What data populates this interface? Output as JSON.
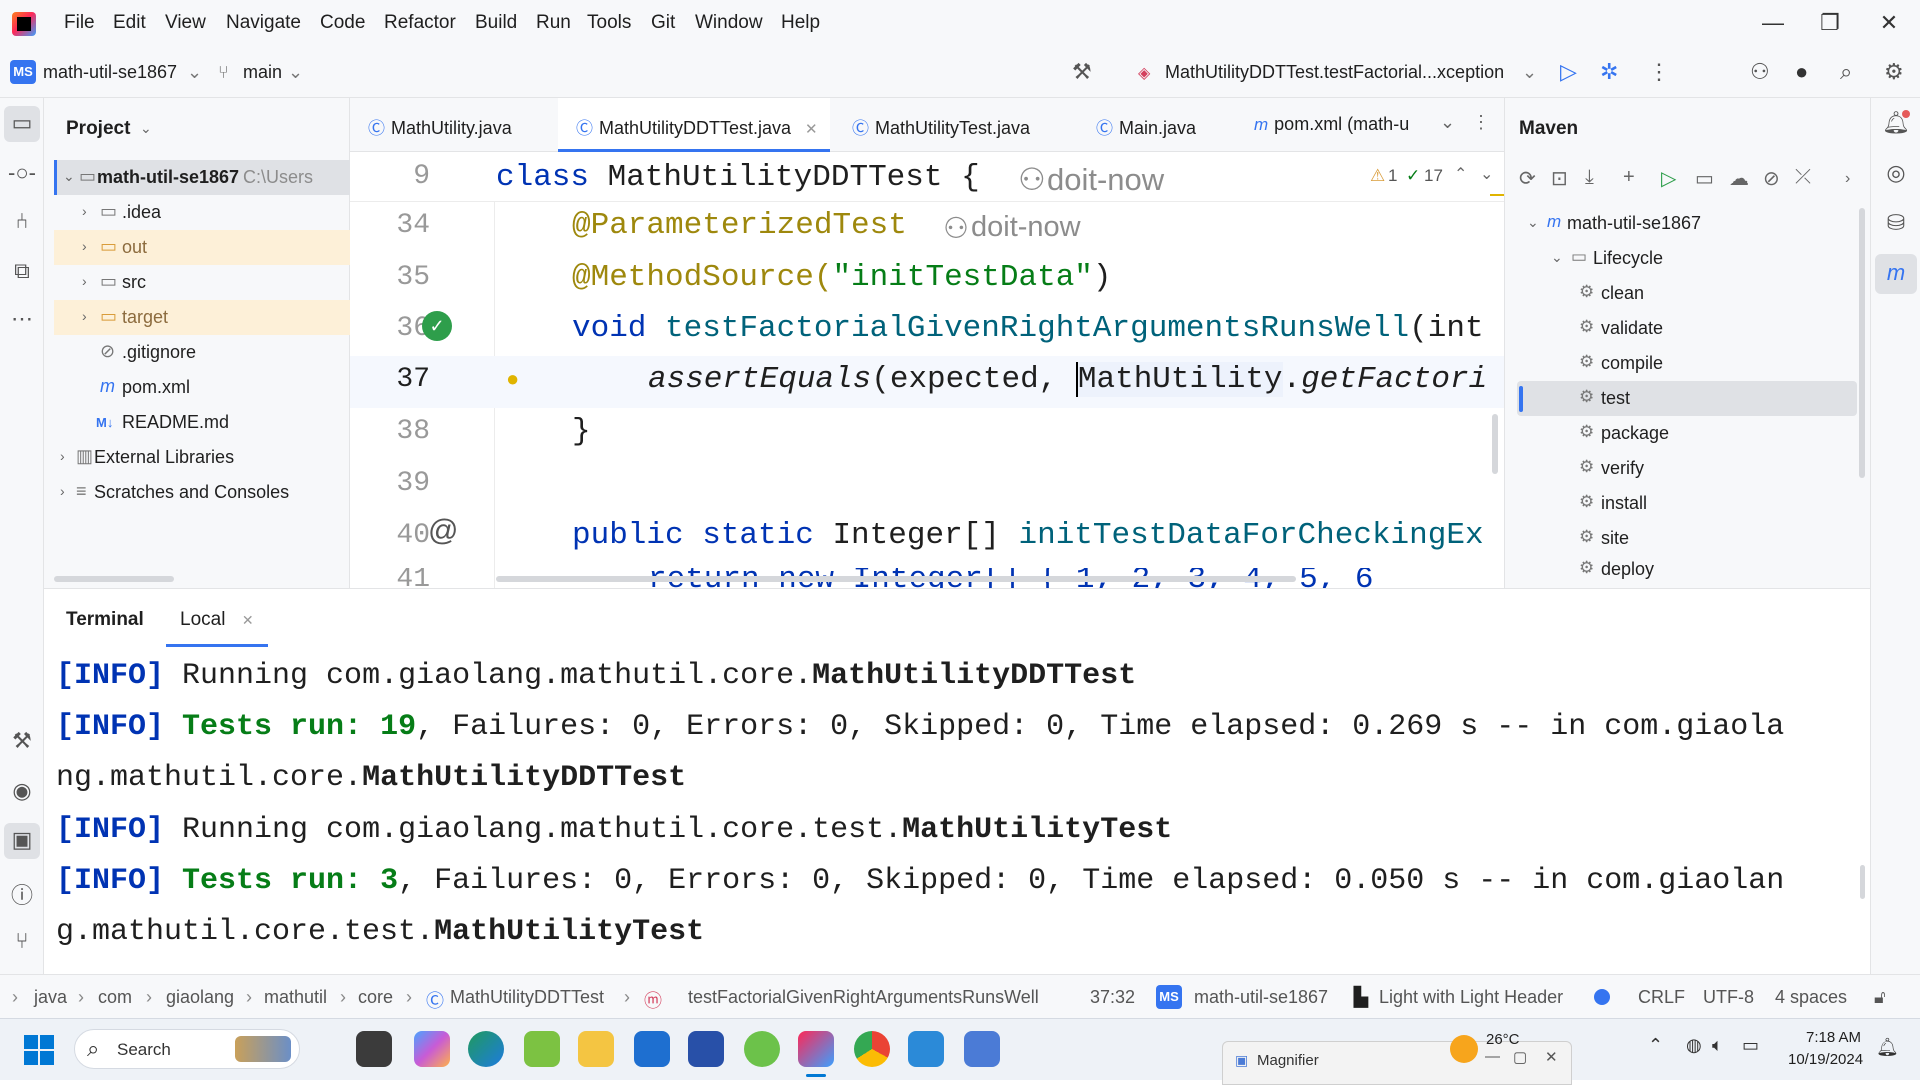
{
  "menubar": {
    "items": [
      "File",
      "Edit",
      "View",
      "Navigate",
      "Code",
      "Refactor",
      "Build",
      "Run",
      "Tools",
      "Git",
      "Window",
      "Help"
    ],
    "minimize": "—",
    "restore": "❐",
    "close": "✕"
  },
  "toolbar": {
    "project_badge": "MS",
    "project_name": "math-util-se1867",
    "branch": "main",
    "run_config": "MathUtilityDDTTest.testFactorial...xception"
  },
  "project_panel": {
    "title": "Project",
    "root": {
      "name": "math-util-se1867",
      "path": "C:\\Users"
    },
    "items": [
      ".idea",
      "out",
      "src",
      "target",
      ".gitignore",
      "pom.xml",
      "README.md",
      "External Libraries",
      "Scratches and Consoles"
    ]
  },
  "editor": {
    "tabs": [
      "MathUtility.java",
      "MathUtilityDDTTest.java",
      "MathUtilityTest.java",
      "Main.java",
      "pom.xml (math-u"
    ],
    "sticky_line": {
      "num": "9",
      "kw": "class",
      "name": "MathUtilityDDTTest {",
      "hint": "doit-now"
    },
    "inspections": {
      "warnings": "1",
      "ok": "17"
    },
    "lines": [
      {
        "num": "34",
        "text": "@ParameterizedTest",
        "hint": "doit-now"
      },
      {
        "num": "35",
        "ann": "@MethodSource(",
        "str": "\"initTestData\"",
        "rest": ")"
      },
      {
        "num": "36",
        "kw": "void",
        "fn": "testFactorialGivenRightArgumentsRunsWell",
        "rest": "(int"
      },
      {
        "num": "37",
        "call": "assertEquals",
        "args": "(expected, ",
        "cls": "MathUtility",
        "dot": ".",
        "method": "getFactori"
      },
      {
        "num": "38",
        "text": "}"
      },
      {
        "num": "39",
        "text": ""
      },
      {
        "num": "40",
        "kw": "public static",
        "type": " Integer[] ",
        "fn": "initTestDataForCheckingEx"
      },
      {
        "num": "41",
        "text": "return new Integer[] { 1,  2,  3,  4,  5,  6"
      }
    ]
  },
  "maven": {
    "title": "Maven",
    "project": "math-util-se1867",
    "lifecycle": "Lifecycle",
    "phases": [
      "clean",
      "validate",
      "compile",
      "test",
      "package",
      "verify",
      "install",
      "site",
      "deploy"
    ]
  },
  "terminal": {
    "title": "Terminal",
    "tab": "Local",
    "lines": [
      {
        "tag": "[INFO]",
        "plain": " Running com.giaolang.mathutil.core.",
        "bold": "MathUtilityDDTTest"
      },
      {
        "tag": "[INFO]",
        "green": " Tests run: 19",
        "plain": ", Failures: 0, Errors: 0, Skipped: 0, Time elapsed: 0.269 s -- in com.giaola"
      },
      {
        "plain": "ng.mathutil.core.",
        "bold": "MathUtilityDDTTest"
      },
      {
        "tag": "[INFO]",
        "plain": " Running com.giaolang.mathutil.core.test.",
        "bold": "MathUtilityTest"
      },
      {
        "tag": "[INFO]",
        "green": " Tests run: 3",
        "plain": ", Failures: 0, Errors: 0, Skipped: 0, Time elapsed: 0.050 s -- in com.giaolan"
      },
      {
        "plain": "g.mathutil.core.test.",
        "bold": "MathUtilityTest"
      }
    ]
  },
  "statusbar": {
    "breadcrumb": [
      "java",
      "com",
      "giaolang",
      "mathutil",
      "core",
      "MathUtilityDDTTest",
      "testFactorialGivenRightArgumentsRunsWell"
    ],
    "position": "37:32",
    "module_badge": "MS",
    "module": "math-util-se1867",
    "theme": "Light with Light Header",
    "line_sep": "CRLF",
    "encoding": "UTF-8",
    "indent": "4 spaces"
  },
  "taskbar": {
    "search": "Search",
    "weather": "26°C",
    "time": "7:18 AM",
    "date": "10/19/2024",
    "magnifier": "Magnifier"
  },
  "colors": {
    "accent": "#3574f0",
    "keyword": "#0033b3",
    "annotation": "#9e880d",
    "string": "#067d17",
    "function": "#00627a",
    "panel_bg": "#f7f8fa"
  }
}
